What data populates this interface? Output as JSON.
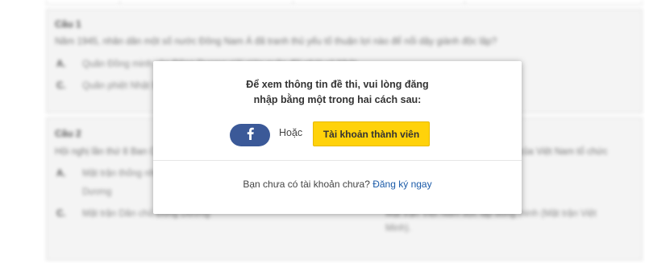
{
  "background": {
    "question1": {
      "title": "Câu 1",
      "prompt": "Năm 1945, nhân dân một số nước Đông Nam Á đã tranh thủ yếu tố thuận lợi nào để nổi dậy giành độc lập?",
      "options": [
        {
          "key": "A.",
          "text": "Quân Đồng minh vào Đông Dương giải giáp quân đội phát xít Nhật."
        },
        {
          "key": "C.",
          "text": "Quân phiệt Nhật Bản suy yếu vì bị quân Đồng minh đánh bại tại chiến trường Nhật Bản."
        }
      ]
    },
    "question2": {
      "title": "Câu 2",
      "prompt": "Hội nghị lần thứ 8 Ban Chấp hành Trung ương Đảng Cộng sản Đông Dương quyết định thành lập mặt trận riêng của Việt Nam tổ chức",
      "options": [
        {
          "key": "A.",
          "text": "Mặt trận thống nhất dân tộc phản đế Đông",
          "cont": "Dương"
        },
        {
          "key": "C.",
          "text": "Mặt trận Dân chủ Đông Dương",
          "right": "Mặt trận Việt Nam độc lập đồng minh (Mặt trận Việt",
          "right_cont": "Minh)."
        }
      ]
    }
  },
  "modal": {
    "heading_line1": "Để xem thông tin đề thi, vui lòng đăng",
    "heading_line2": "nhập bằng một trong hai cách sau:",
    "facebook_icon": "facebook-icon",
    "or_label": "Hoặc",
    "member_button_label": "Tài khoản thành viên",
    "footer_text": "Bạn chưa có tài khoản chưa?",
    "register_link": "Đăng ký ngay"
  },
  "colors": {
    "facebook": "#3b5998",
    "member_button": "#ffd20a",
    "link": "#1a5aa8"
  }
}
